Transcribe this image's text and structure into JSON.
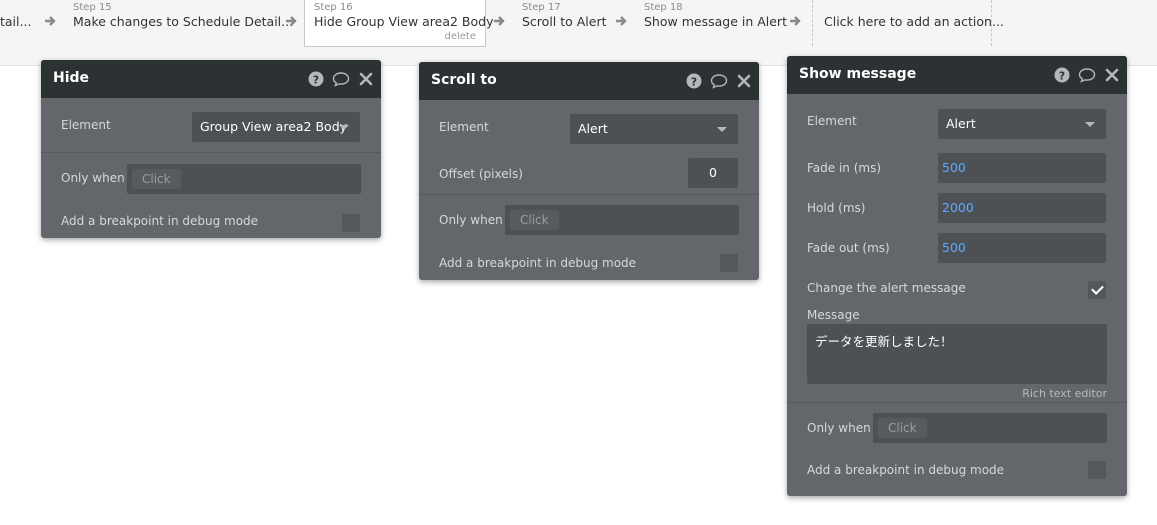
{
  "steps": [
    {
      "num": "",
      "title": "tail...",
      "selected": false
    },
    {
      "num": "Step 15",
      "title": "Make changes to Schedule Detail...",
      "selected": false
    },
    {
      "num": "Step 16",
      "title": "Hide Group View area2 Body",
      "selected": true,
      "delete_label": "delete"
    },
    {
      "num": "Step 17",
      "title": "Scroll to Alert",
      "selected": false
    },
    {
      "num": "Step 18",
      "title": "Show message in Alert",
      "selected": false
    }
  ],
  "add_action_label": "Click here to add an action...",
  "colors": {
    "panel_header": "#2c3133",
    "panel_body": "#63666a",
    "value_blue": "#5da9ff"
  },
  "hide_panel": {
    "title": "Hide",
    "element_label": "Element",
    "element_value": "Group View area2 Body",
    "only_when_label": "Only when",
    "only_when_placeholder": "Click",
    "breakpoint_label": "Add a breakpoint in debug mode"
  },
  "scroll_panel": {
    "title": "Scroll to",
    "element_label": "Element",
    "element_value": "Alert",
    "offset_label": "Offset (pixels)",
    "offset_value": "0",
    "only_when_label": "Only when",
    "only_when_placeholder": "Click",
    "breakpoint_label": "Add a breakpoint in debug mode"
  },
  "message_panel": {
    "title": "Show message",
    "element_label": "Element",
    "element_value": "Alert",
    "fade_in_label": "Fade in (ms)",
    "fade_in_value": "500",
    "hold_label": "Hold (ms)",
    "hold_value": "2000",
    "fade_out_label": "Fade out (ms)",
    "fade_out_value": "500",
    "change_message_label": "Change the alert message",
    "change_message_checked": true,
    "message_label": "Message",
    "message_value": "データを更新しました！",
    "rich_text_label": "Rich text editor",
    "only_when_label": "Only when",
    "only_when_placeholder": "Click",
    "breakpoint_label": "Add a breakpoint in debug mode"
  },
  "icons": [
    "help-icon",
    "comment-icon",
    "close-icon",
    "chevron-right-icon",
    "chevron-down-icon",
    "checkmark-icon"
  ]
}
